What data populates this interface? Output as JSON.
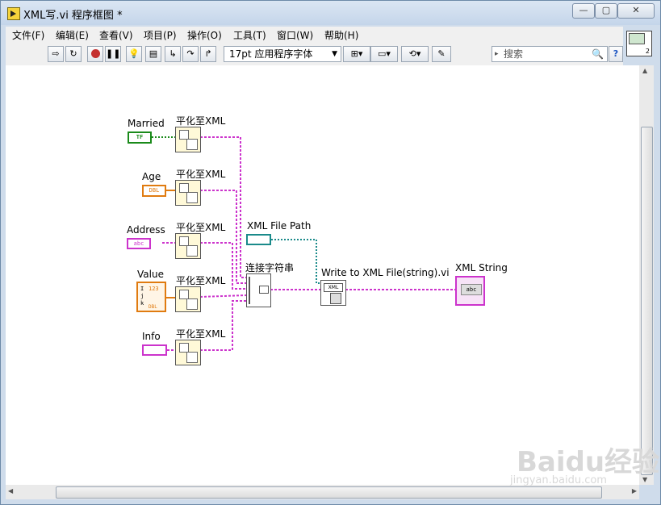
{
  "window": {
    "title": "XML写.vi 程序框图 *"
  },
  "menu": [
    "文件(F)",
    "编辑(E)",
    "查看(V)",
    "项目(P)",
    "操作(O)",
    "工具(T)",
    "窗口(W)",
    "帮助(H)"
  ],
  "toolbar": {
    "font": "17pt 应用程序字体",
    "search_placeholder": "搜索",
    "help": "?"
  },
  "diagram": {
    "controls": {
      "married": "Married",
      "age": "Age",
      "address": "Address",
      "value": "Value",
      "info": "Info"
    },
    "terminal_text": {
      "married": "TF",
      "age": "DBL",
      "address": "abc",
      "value_type": "DBL",
      "value_i": "I",
      "value_j": "j",
      "value_k": "k",
      "value_123": "123"
    },
    "flatten_label": "平化至XML",
    "concat_label": "连接字符串",
    "xml_file_path": "XML File Path",
    "write_vi": "Write to XML File(string).vi",
    "write_icon_text": "XML",
    "xml_string": "XML String",
    "xml_string_text": "abc"
  },
  "watermark": {
    "brand": "Baidu经验",
    "url": "jingyan.baidu.com"
  },
  "colors": {
    "string_wire": "#cc33cc",
    "bool": "#1a8a1a",
    "dbl": "#e07b10",
    "path": "#1a8a8a"
  }
}
